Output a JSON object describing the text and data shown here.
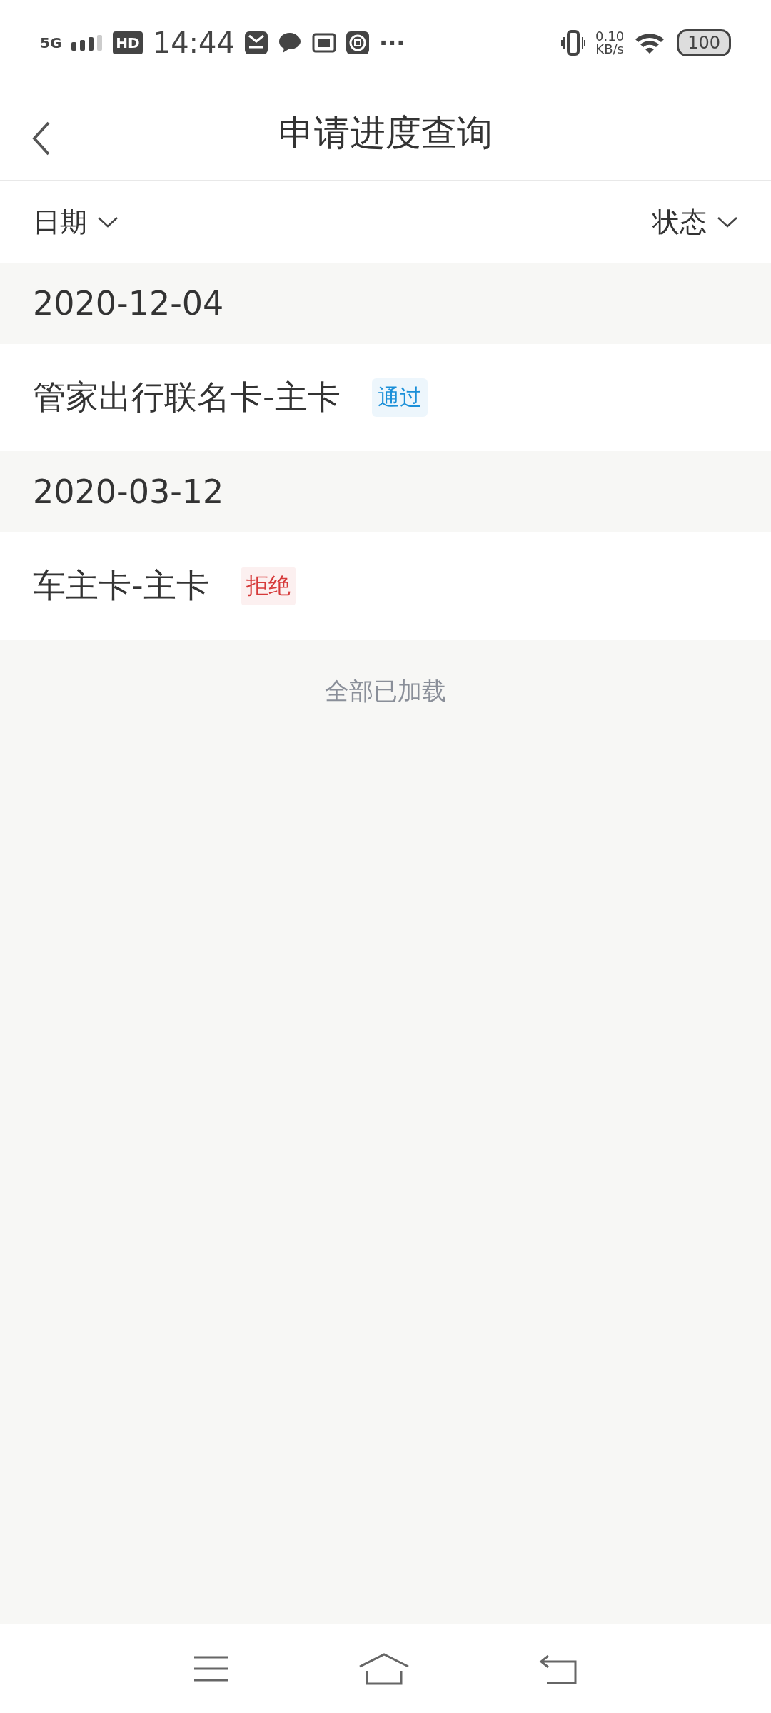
{
  "status_bar": {
    "network": "5G",
    "hd": "HD",
    "time": "14:44",
    "more": "···",
    "speed_value": "0.10",
    "speed_unit": "KB/s",
    "battery": "100"
  },
  "header": {
    "title": "申请进度查询"
  },
  "filters": [
    {
      "label": "日期"
    },
    {
      "label": "状态"
    }
  ],
  "groups": [
    {
      "date": "2020-12-04",
      "items": [
        {
          "name": "管家出行联名卡-主卡",
          "status": "通过",
          "color": "#1a8fd8"
        }
      ]
    },
    {
      "date": "2020-03-12",
      "items": [
        {
          "name": "车主卡-主卡",
          "status": "拒绝",
          "color": "#d63a3a"
        }
      ]
    }
  ],
  "footer": {
    "text": "全部已加载"
  }
}
